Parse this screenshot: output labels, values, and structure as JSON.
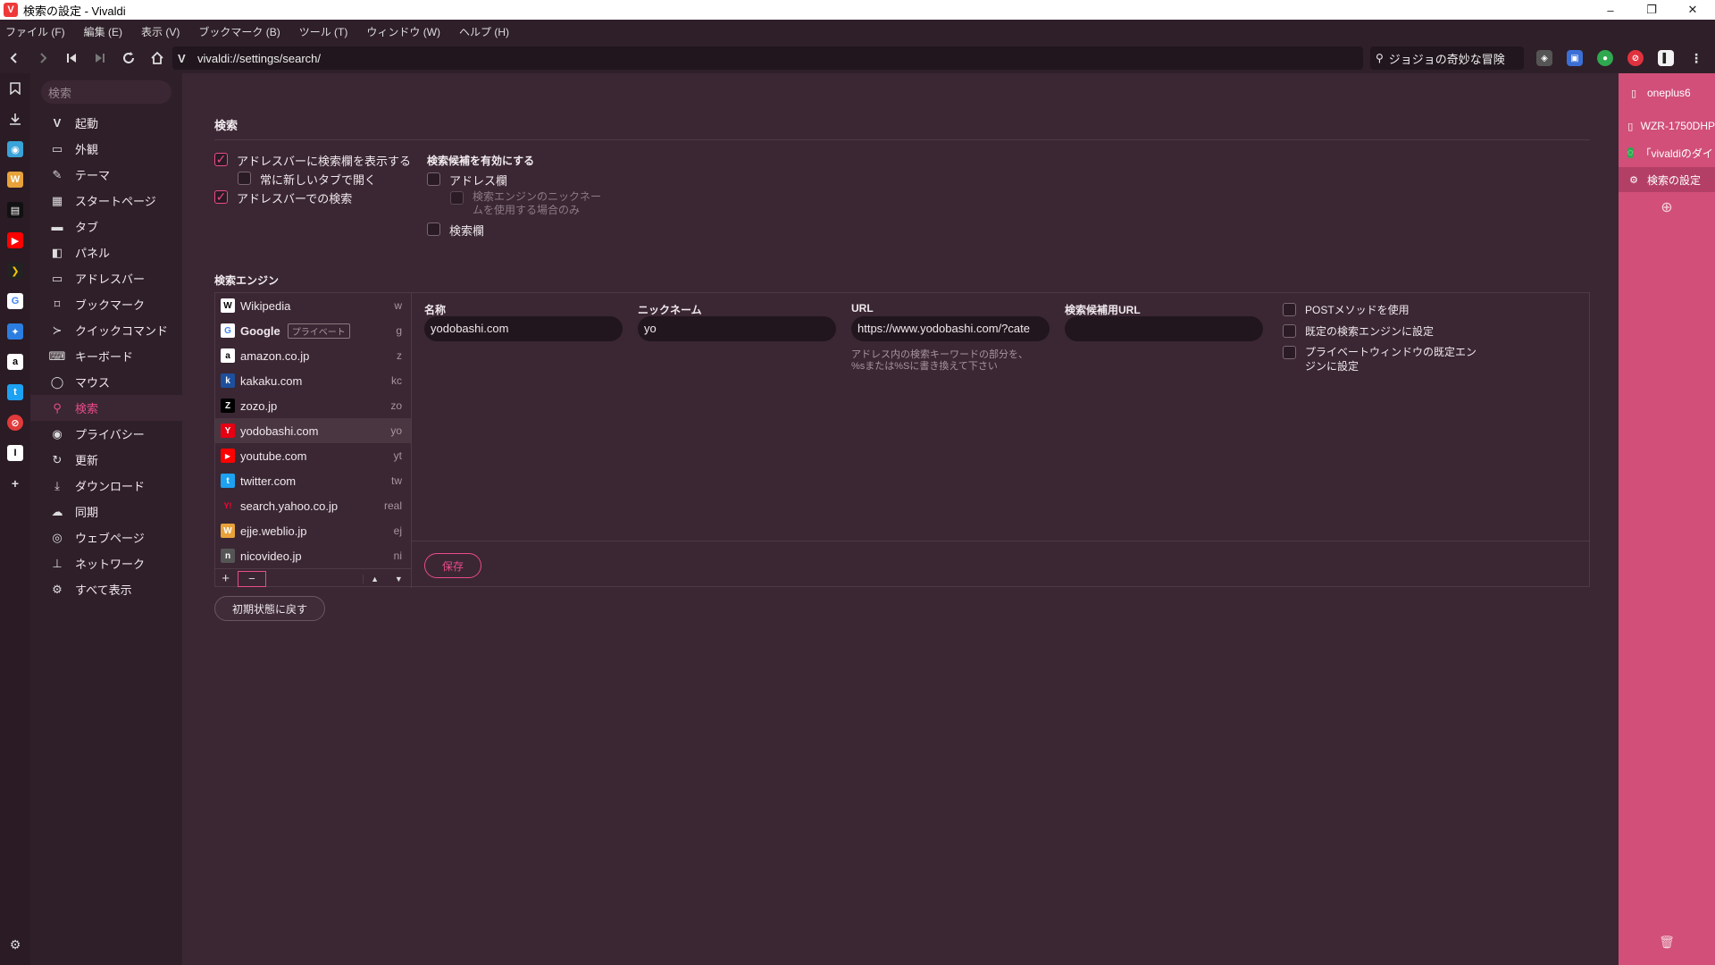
{
  "window": {
    "title": "検索の設定 - Vivaldi",
    "logo": "V",
    "controls": {
      "minimize": "–",
      "restore": "❐",
      "close": "✕"
    }
  },
  "menubar": [
    "ファイル (F)",
    "編集 (E)",
    "表示 (V)",
    "ブックマーク (B)",
    "ツール (T)",
    "ウィンドウ (W)",
    "ヘルプ (H)"
  ],
  "address": {
    "url": "vivaldi://settings/search/",
    "search_text": "ジョジョの奇妙な冒険"
  },
  "nav": {
    "search_placeholder": "検索",
    "items": [
      {
        "label": "起動",
        "icon": "vivaldi-icon"
      },
      {
        "label": "外観",
        "icon": "window-icon"
      },
      {
        "label": "テーマ",
        "icon": "brush-icon"
      },
      {
        "label": "スタートページ",
        "icon": "grid-icon"
      },
      {
        "label": "タブ",
        "icon": "tab-icon"
      },
      {
        "label": "パネル",
        "icon": "panel-icon"
      },
      {
        "label": "アドレスバー",
        "icon": "addressbar-icon"
      },
      {
        "label": "ブックマーク",
        "icon": "bookmark-icon"
      },
      {
        "label": "クイックコマンド",
        "icon": "quick-command-icon"
      },
      {
        "label": "キーボード",
        "icon": "keyboard-icon"
      },
      {
        "label": "マウス",
        "icon": "mouse-icon"
      },
      {
        "label": "検索",
        "icon": "search-icon"
      },
      {
        "label": "プライバシー",
        "icon": "eye-icon"
      },
      {
        "label": "更新",
        "icon": "refresh-icon"
      },
      {
        "label": "ダウンロード",
        "icon": "download-icon"
      },
      {
        "label": "同期",
        "icon": "cloud-icon"
      },
      {
        "label": "ウェブページ",
        "icon": "globe-icon"
      },
      {
        "label": "ネットワーク",
        "icon": "network-icon"
      },
      {
        "label": "すべて表示",
        "icon": "gear-icon"
      }
    ]
  },
  "search_section": {
    "title": "検索",
    "show_search_field": "アドレスバーに検索欄を表示する",
    "always_new_tab": "常に新しいタブで開く",
    "search_in_addressbar": "アドレスバーでの検索",
    "suggest_title": "検索候補を有効にする",
    "suggest_address": "アドレス欄",
    "suggest_nickname_only": "検索エンジンのニックネームを使用する場合のみ",
    "suggest_searchfield": "検索欄"
  },
  "engines_section": {
    "title": "検索エンジン",
    "private_tag": "プライベート",
    "engines": [
      {
        "name": "Wikipedia",
        "nick": "w",
        "fav": "W",
        "color": "#ffffff",
        "fg": "#000000"
      },
      {
        "name": "Google",
        "nick": "g",
        "fav": "G",
        "color": "#ffffff",
        "fg": "#4285f4"
      },
      {
        "name": "amazon.co.jp",
        "nick": "z",
        "fav": "a",
        "color": "#ffffff",
        "fg": "#000000"
      },
      {
        "name": "kakaku.com",
        "nick": "kc",
        "fav": "k",
        "color": "#1d4f9c",
        "fg": "#ffffff"
      },
      {
        "name": "zozo.jp",
        "nick": "zo",
        "fav": "Z",
        "color": "#000000",
        "fg": "#ffffff"
      },
      {
        "name": "yodobashi.com",
        "nick": "yo",
        "fav": "Y",
        "color": "#e60012",
        "fg": "#ffffff"
      },
      {
        "name": "youtube.com",
        "nick": "yt",
        "fav": "▶",
        "color": "#ff0000",
        "fg": "#ffffff"
      },
      {
        "name": "twitter.com",
        "nick": "tw",
        "fav": "t",
        "color": "#1da1f2",
        "fg": "#ffffff"
      },
      {
        "name": "search.yahoo.co.jp",
        "nick": "real",
        "fav": "Y!",
        "color": "#3a2733",
        "fg": "#ff0033"
      },
      {
        "name": "ejje.weblio.jp",
        "nick": "ej",
        "fav": "W",
        "color": "#e8a23a",
        "fg": "#ffffff"
      },
      {
        "name": "nicovideo.jp",
        "nick": "ni",
        "fav": "n",
        "color": "#3a2733",
        "fg": "#ffffff"
      }
    ],
    "add_btn": "+",
    "remove_btn": "−",
    "up_btn": "▲",
    "down_btn": "▼",
    "detail": {
      "name_label": "名称",
      "name_value": "yodobashi.com",
      "nick_label": "ニックネーム",
      "nick_value": "yo",
      "url_label": "URL",
      "url_value": "https://www.yodobashi.com/?cate",
      "url_hint": "アドレス内の検索キーワードの部分を、%sまたは%Sに書き換えて下さい",
      "suggest_url_label": "検索候補用URL",
      "suggest_url_value": "",
      "post_method": "POSTメソッドを使用",
      "set_default": "既定の検索エンジンに設定",
      "set_private_default": "プライベートウィンドウの既定エンジンに設定"
    },
    "save_btn": "保存",
    "reset_btn": "初期状態に戻す"
  },
  "right_panel": {
    "items": [
      {
        "label": "oneplus6",
        "icon": "page-icon"
      },
      {
        "label": "WZR-1750DHP",
        "icon": "page-icon"
      },
      {
        "label": "「vivaldiのダイレ",
        "icon": "chat-icon"
      },
      {
        "label": "検索の設定",
        "icon": "gear-icon"
      }
    ],
    "add": "⊕",
    "trash": "🗑"
  },
  "colors": {
    "accent": "#e94b8a",
    "panel": "#d14f79",
    "bg": "#3a2733"
  }
}
